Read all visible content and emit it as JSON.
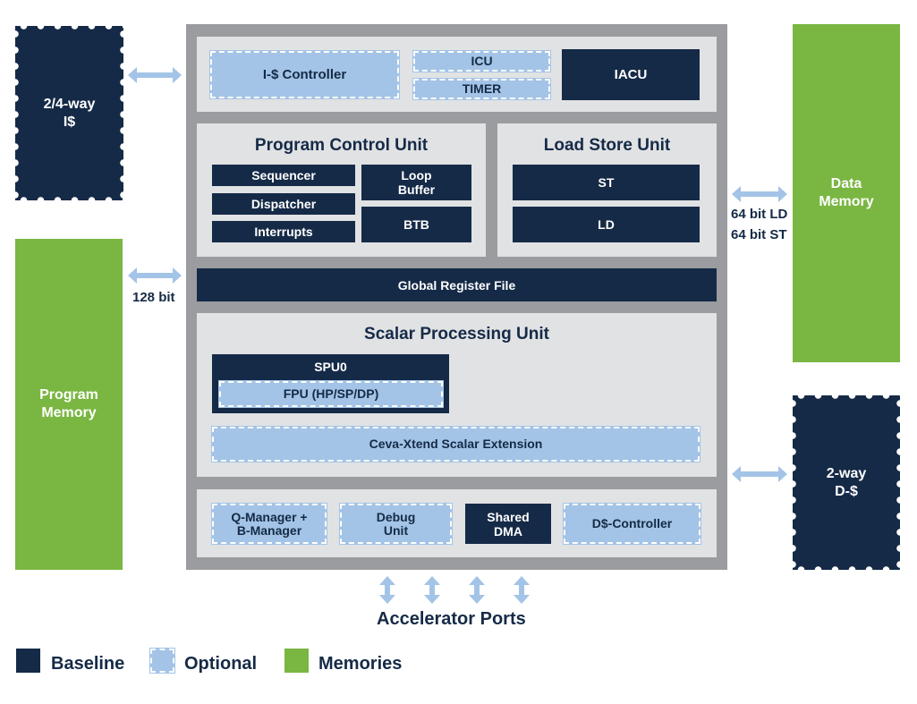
{
  "colors": {
    "baseline": "#152a47",
    "optional": "#a3c4e6",
    "memories": "#7ab642",
    "frame": "#9a9c9f",
    "panel": "#e1e2e4"
  },
  "external": {
    "icache": "2/4-way\nI$",
    "program_memory": "Program\nMemory",
    "data_memory": "Data\nMemory",
    "dcache": "2-way\nD-$"
  },
  "links": {
    "program_bus": "128 bit",
    "data_ld": "64 bit LD",
    "data_st": "64 bit ST"
  },
  "top": {
    "icache_controller": "I-$ Controller",
    "icu": "ICU",
    "timer": "TIMER",
    "iacu": "IACU"
  },
  "pcu": {
    "title": "Program Control Unit",
    "sequencer": "Sequencer",
    "dispatcher": "Dispatcher",
    "interrupts": "Interrupts",
    "loop_buffer": "Loop\nBuffer",
    "btb": "BTB"
  },
  "lsu": {
    "title": "Load Store Unit",
    "st": "ST",
    "ld": "LD"
  },
  "grf": "Global Register File",
  "spu": {
    "title": "Scalar Processing Unit",
    "spu0": "SPU0",
    "fpu": "FPU (HP/SP/DP)",
    "xtend": "Ceva-Xtend Scalar Extension"
  },
  "bottom": {
    "qmanager": "Q-Manager +\nB-Manager",
    "debug": "Debug\nUnit",
    "dma": "Shared\nDMA",
    "dcache_controller": "D$-Controller"
  },
  "accelerator_ports": "Accelerator Ports",
  "legend": {
    "baseline": "Baseline",
    "optional": "Optional",
    "memories": "Memories"
  }
}
